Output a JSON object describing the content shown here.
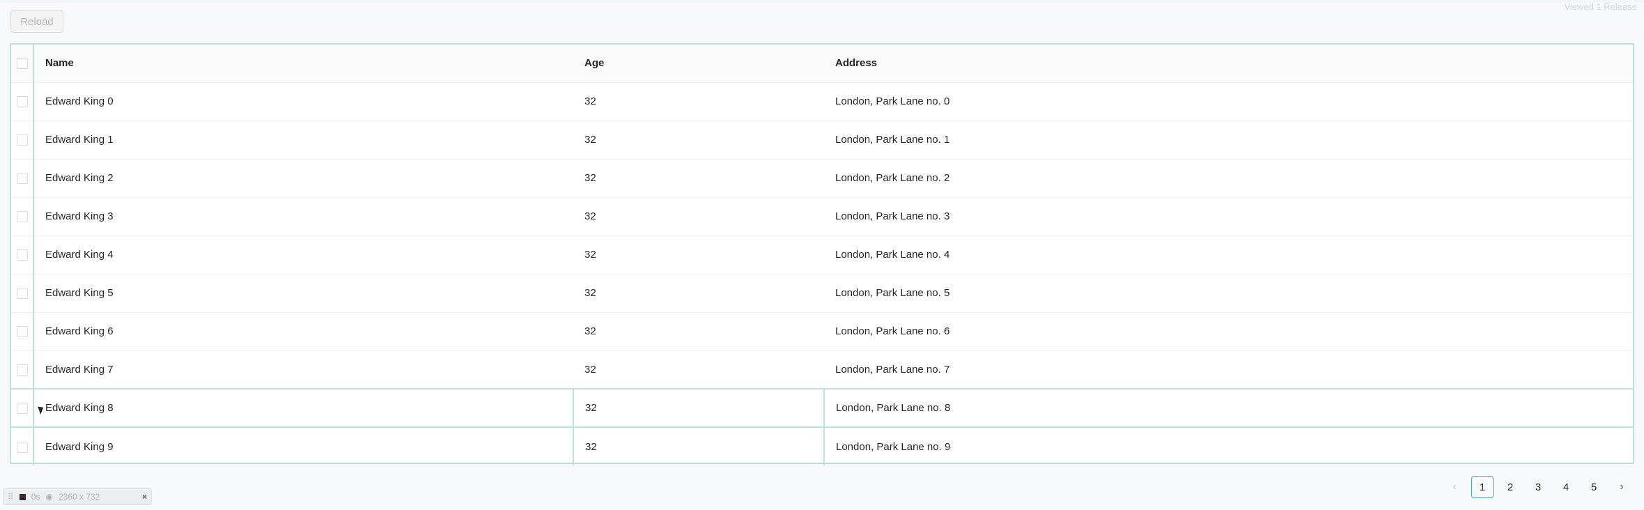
{
  "toolbar": {
    "reload_label": "Reload"
  },
  "watermark": "Viewed 1 Release",
  "table": {
    "columns": [
      "Name",
      "Age",
      "Address"
    ],
    "rows": [
      {
        "name": "Edward King 0",
        "age": "32",
        "address": "London, Park Lane no. 0"
      },
      {
        "name": "Edward King 1",
        "age": "32",
        "address": "London, Park Lane no. 1"
      },
      {
        "name": "Edward King 2",
        "age": "32",
        "address": "London, Park Lane no. 2"
      },
      {
        "name": "Edward King 3",
        "age": "32",
        "address": "London, Park Lane no. 3"
      },
      {
        "name": "Edward King 4",
        "age": "32",
        "address": "London, Park Lane no. 4"
      },
      {
        "name": "Edward King 5",
        "age": "32",
        "address": "London, Park Lane no. 5"
      },
      {
        "name": "Edward King 6",
        "age": "32",
        "address": "London, Park Lane no. 6"
      },
      {
        "name": "Edward King 7",
        "age": "32",
        "address": "London, Park Lane no. 7"
      },
      {
        "name": "Edward King 8",
        "age": "32",
        "address": "London, Park Lane no. 8"
      },
      {
        "name": "Edward King 9",
        "age": "32",
        "address": "London, Park Lane no. 9"
      }
    ]
  },
  "pagination": {
    "prev_icon": "‹",
    "next_icon": "›",
    "pages": [
      "1",
      "2",
      "3",
      "4",
      "5"
    ],
    "current": "1"
  },
  "devbar": {
    "label_1": "0s",
    "size": "2360 x 732",
    "close": "×"
  },
  "colors": {
    "accent": "#4aa8a6",
    "highlight_border": "#b9e2e1"
  }
}
